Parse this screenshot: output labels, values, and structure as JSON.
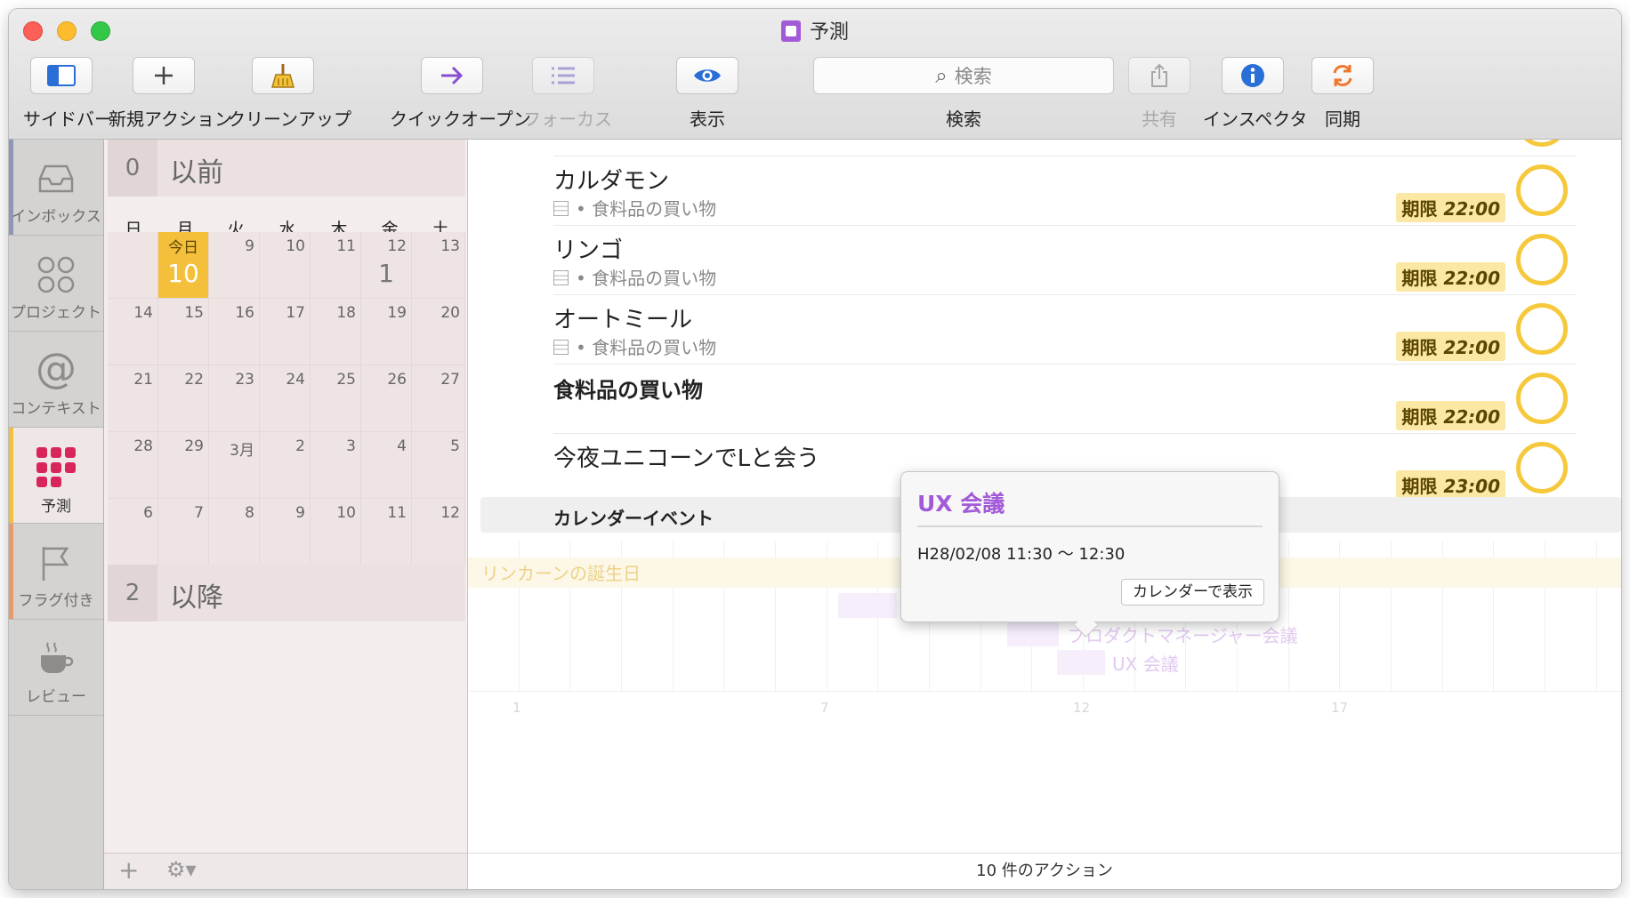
{
  "window": {
    "title": "予測"
  },
  "toolbar": {
    "sidebar": "サイドバー",
    "new_action": "新規アクション",
    "cleanup": "クリーンアップ",
    "quick_open": "クイックオープン",
    "focus": "フォーカス",
    "view": "表示",
    "search_placeholder": "検索",
    "search": "検索",
    "share": "共有",
    "inspector": "インスペクタ",
    "sync": "同期"
  },
  "perspectives": [
    {
      "label": "インボックス"
    },
    {
      "label": "プロジェクト"
    },
    {
      "label": "コンテキスト"
    },
    {
      "label": "予測"
    },
    {
      "label": "フラグ付き"
    },
    {
      "label": "レビュー"
    }
  ],
  "calendar": {
    "past": {
      "count": "0",
      "label": "以前"
    },
    "future": {
      "count": "2",
      "label": "以降"
    },
    "weekdays": [
      "日",
      "月",
      "火",
      "水",
      "木",
      "金",
      "土"
    ],
    "today_label": "今日",
    "week1": [
      {
        "day": "",
        "count": ""
      },
      {
        "day": "",
        "count": "10",
        "today": true
      },
      {
        "day": "9",
        "count": ""
      },
      {
        "day": "10",
        "count": ""
      },
      {
        "day": "11",
        "count": ""
      },
      {
        "day": "12",
        "count": "1"
      },
      {
        "day": "13",
        "count": ""
      }
    ],
    "week2": [
      "14",
      "15",
      "16",
      "17",
      "18",
      "19",
      "20"
    ],
    "week3": [
      "21",
      "22",
      "23",
      "24",
      "25",
      "26",
      "27"
    ],
    "week4": [
      "28",
      "29",
      "3月",
      "2",
      "3",
      "4",
      "5"
    ],
    "week5": [
      "6",
      "7",
      "8",
      "9",
      "10",
      "11",
      "12"
    ]
  },
  "actions": [
    {
      "title": "カルダモン",
      "context": "食料品の買い物",
      "due_prefix": "期限",
      "due_time": "22:00"
    },
    {
      "title": "リンゴ",
      "context": "食料品の買い物",
      "due_prefix": "期限",
      "due_time": "22:00"
    },
    {
      "title": "オートミール",
      "context": "食料品の買い物",
      "due_prefix": "期限",
      "due_time": "22:00"
    },
    {
      "title": "食料品の買い物",
      "context": "",
      "due_prefix": "期限",
      "due_time": "22:00"
    },
    {
      "title": "今夜ユニコーンでLと会う",
      "context": "",
      "due_prefix": "期限",
      "due_time": "23:00"
    }
  ],
  "events_section": {
    "header": "カレンダーイベント",
    "all_day": "リンカーンの誕生日",
    "events": [
      "プロダクトマネージャー会議",
      "UX 会議"
    ],
    "ticks": [
      "1",
      "7",
      "12",
      "17"
    ]
  },
  "popover": {
    "title": "UX 会議",
    "time": "H28/02/08 11:30 〜 12:30",
    "button": "カレンダーで表示"
  },
  "status": {
    "action_count": "10 件のアクション"
  },
  "colors": {
    "accent": "#a35ad8",
    "due_badge": "#fbe8a4",
    "today": "#f4bf3b",
    "forecast": "#d8265c"
  }
}
